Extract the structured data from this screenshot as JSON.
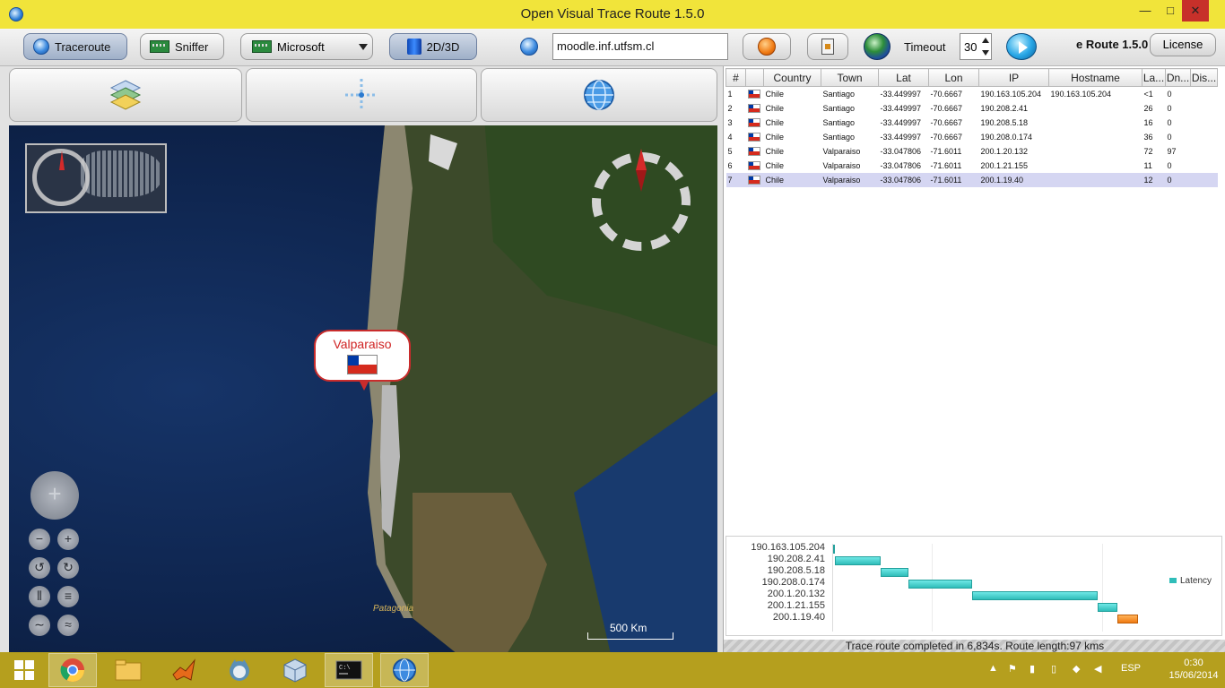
{
  "window": {
    "title": "Open Visual Trace Route 1.5.0",
    "min_label": "—",
    "max_label": "□",
    "close_label": "✕"
  },
  "toolbar": {
    "traceroute_label": "Traceroute",
    "sniffer_label": "Sniffer",
    "interface_value": "Microsoft",
    "view_label": "2D/3D",
    "host_value": "moodle.inf.utfsm.cl",
    "timeout_label": "Timeout",
    "timeout_value": "30",
    "version_label": "e Route 1.5.0",
    "license_label": "License"
  },
  "map": {
    "city_label": "Valparaiso",
    "region_label": "Patagonia",
    "scale_label": "500 Km"
  },
  "table": {
    "headers": [
      "#",
      "",
      "Country",
      "Town",
      "Lat",
      "Lon",
      "IP",
      "Hostname",
      "La...",
      "Dn...",
      "Dis..."
    ],
    "rows": [
      {
        "num": "1",
        "country": "Chile",
        "town": "Santiago",
        "lat": "-33.449997",
        "lon": "-70.6667",
        "ip": "190.163.105.204",
        "hostname": "190.163.105.204",
        "latency": "<1",
        "dns": "0",
        "dist": ""
      },
      {
        "num": "2",
        "country": "Chile",
        "town": "Santiago",
        "lat": "-33.449997",
        "lon": "-70.6667",
        "ip": "190.208.2.41",
        "hostname": "",
        "latency": "26",
        "dns": "0",
        "dist": ""
      },
      {
        "num": "3",
        "country": "Chile",
        "town": "Santiago",
        "lat": "-33.449997",
        "lon": "-70.6667",
        "ip": "190.208.5.18",
        "hostname": "",
        "latency": "16",
        "dns": "0",
        "dist": ""
      },
      {
        "num": "4",
        "country": "Chile",
        "town": "Santiago",
        "lat": "-33.449997",
        "lon": "-70.6667",
        "ip": "190.208.0.174",
        "hostname": "",
        "latency": "36",
        "dns": "0",
        "dist": ""
      },
      {
        "num": "5",
        "country": "Chile",
        "town": "Valparaiso",
        "lat": "-33.047806",
        "lon": "-71.6011",
        "ip": "200.1.20.132",
        "hostname": "",
        "latency": "72",
        "dns": "97",
        "dist": ""
      },
      {
        "num": "6",
        "country": "Chile",
        "town": "Valparaiso",
        "lat": "-33.047806",
        "lon": "-71.6011",
        "ip": "200.1.21.155",
        "hostname": "",
        "latency": "11",
        "dns": "0",
        "dist": ""
      },
      {
        "num": "7",
        "country": "Chile",
        "town": "Valparaiso",
        "lat": "-33.047806",
        "lon": "-71.6011",
        "ip": "200.1.19.40",
        "hostname": "",
        "latency": "12",
        "dns": "0",
        "dist": ""
      }
    ]
  },
  "chart_data": {
    "type": "bar",
    "categories": [
      "190.163.105.204",
      "190.208.2.41",
      "190.208.5.18",
      "190.208.0.174",
      "200.1.20.132",
      "200.1.21.155",
      "200.1.19.40"
    ],
    "series": [
      {
        "name": "Latency",
        "start": [
          0,
          1,
          27,
          43,
          79,
          151,
          162
        ],
        "values": [
          1,
          26,
          16,
          36,
          72,
          11,
          12
        ]
      }
    ],
    "xlim": [
      0,
      185
    ],
    "colors": {
      "bar": "#2fbdb9",
      "last_bar": "#f07a12"
    }
  },
  "status": {
    "text": "Trace route completed in 6,834s. Route length:97 kms"
  },
  "taskbar": {
    "lang": "ESP",
    "time": "0:30",
    "date": "15/06/2014"
  }
}
